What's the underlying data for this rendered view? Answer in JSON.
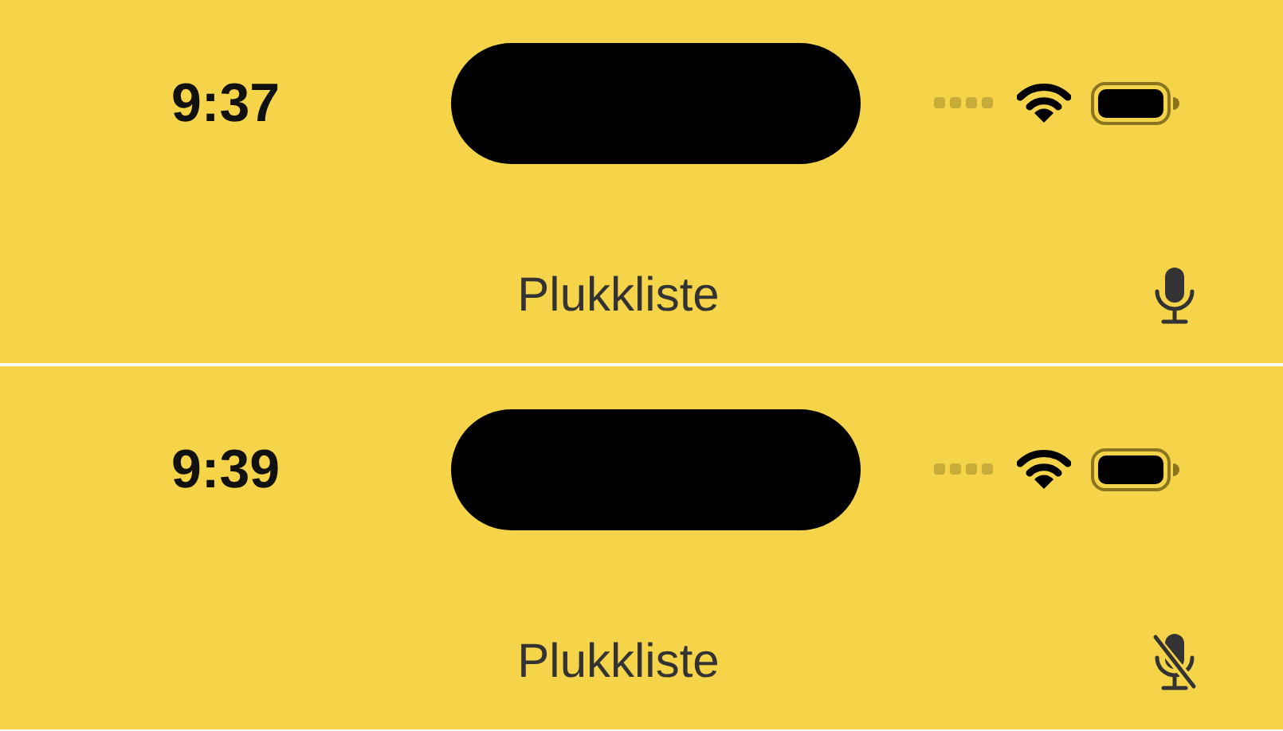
{
  "screens": [
    {
      "time": "9:37",
      "title": "Plukkliste",
      "mic": {
        "muted": false
      }
    },
    {
      "time": "9:39",
      "title": "Plukkliste",
      "mic": {
        "muted": true
      }
    }
  ]
}
